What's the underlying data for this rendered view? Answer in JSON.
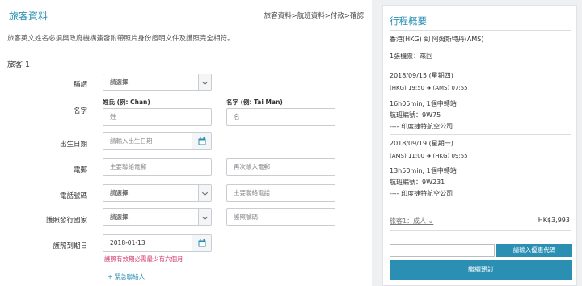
{
  "left": {
    "title": "旅客資料",
    "breadcrumb": "旅客資料>航班資料>付款>確認",
    "notice": "旅客英文姓名必須與政府機構簽發附帶照片身份證明文件及護照完全相符。",
    "passenger_heading": "旅客 1",
    "labels": {
      "title": "稱謂",
      "name": "名字",
      "dob": "出生日期",
      "email": "電郵",
      "phone": "電話號碼",
      "passport_country": "護照發行國家",
      "passport_expiry": "護照到期日"
    },
    "title_select": "請選擇",
    "surname_label": "姓氏 (例: Chan)",
    "givenname_label": "名字 (例: Tai Man)",
    "surname_placeholder": "姓",
    "givenname_placeholder": "名",
    "dob_placeholder": "請輸入出生日期",
    "email_placeholder": "主要聯絡電郵",
    "email_confirm_placeholder": "再次輸入電郵",
    "phone_code_select": "請選擇",
    "phone_placeholder": "主要聯絡電話",
    "passport_country_select": "請選擇",
    "passport_number_placeholder": "護照號碼",
    "passport_expiry_value": "2018-01-13",
    "warning": "護照有效期必需最少有六個月",
    "add_contact": "+ 緊急聯絡人"
  },
  "right": {
    "title": "行程概要",
    "route": "香港(HKG) 到 阿姆斯特丹(AMS)",
    "ticket_type": "1張機票：來回",
    "outbound": {
      "date": "2018/09/15 (星期四)",
      "times_from": "(HKG) 19:50",
      "times_to": "(AMS) 07:55",
      "duration": "16h05min, 1個中轉站",
      "flight": "航班編號：9W75",
      "airline": "---- 印度捷特航空公司"
    },
    "inbound": {
      "date": "2018/09/19 (星期一)",
      "times_from": "(AMS) 11:00",
      "times_to": "(HKG) 09:55",
      "duration": "13h50min, 1個中轉站",
      "flight": "航班編號：9W231",
      "airline": "---- 印度捷特航空公司"
    },
    "fare_label": "旅客1：成人 ⌄",
    "fare_amount": "HK$3,993",
    "promo_button": "請輸入優惠代碼",
    "continue_button": "繼續預訂"
  },
  "colors": {
    "accent": "#2b8fb3",
    "warning": "#d0386a",
    "background": "#eef0f2"
  }
}
